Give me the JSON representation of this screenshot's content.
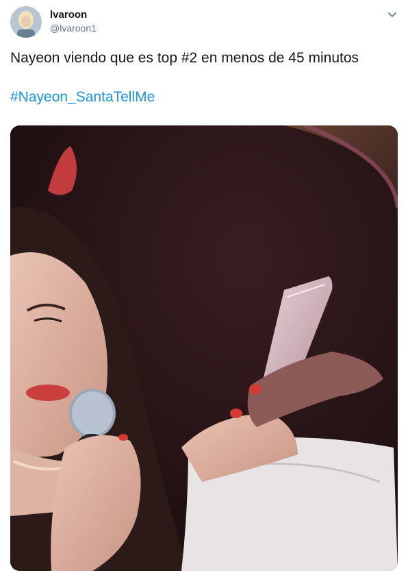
{
  "tweet": {
    "author_name": "lvaroon",
    "author_handle": "@lvaroon1",
    "text": "Nayeon viendo que es top #2 en menos de 45 minutos",
    "hashtag": "#Nayeon_SantaTellMe"
  },
  "icons": {
    "avatar": "avatar-photo",
    "menu": "chevron-down-icon"
  },
  "colors": {
    "link": "#1b95e0",
    "secondary_text": "#657786",
    "primary_text": "#14171a"
  }
}
